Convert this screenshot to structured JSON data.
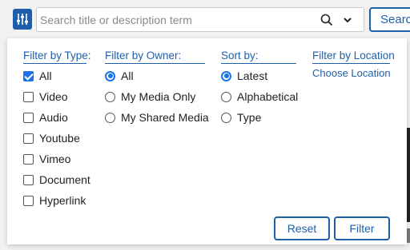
{
  "search": {
    "placeholder": "Search title or description term",
    "button_label": "Search"
  },
  "filters": {
    "type": {
      "title": "Filter by Type:",
      "options": [
        {
          "label": "All",
          "checked": true
        },
        {
          "label": "Video",
          "checked": false
        },
        {
          "label": "Audio",
          "checked": false
        },
        {
          "label": "Youtube",
          "checked": false
        },
        {
          "label": "Vimeo",
          "checked": false
        },
        {
          "label": "Document",
          "checked": false
        },
        {
          "label": "Hyperlink",
          "checked": false
        }
      ]
    },
    "owner": {
      "title": "Filter by Owner:",
      "options": [
        {
          "label": "All",
          "selected": true
        },
        {
          "label": "My Media Only",
          "selected": false
        },
        {
          "label": "My Shared Media",
          "selected": false
        }
      ]
    },
    "sort": {
      "title": "Sort by:",
      "options": [
        {
          "label": "Latest",
          "selected": true
        },
        {
          "label": "Alphabetical",
          "selected": false
        },
        {
          "label": "Type",
          "selected": false
        }
      ]
    },
    "location": {
      "title": "Filter by Location",
      "link": "Choose Location"
    }
  },
  "actions": {
    "reset_label": "Reset",
    "filter_label": "Filter"
  },
  "colors": {
    "accent": "#1f5fa9",
    "check": "#1a73e8"
  }
}
